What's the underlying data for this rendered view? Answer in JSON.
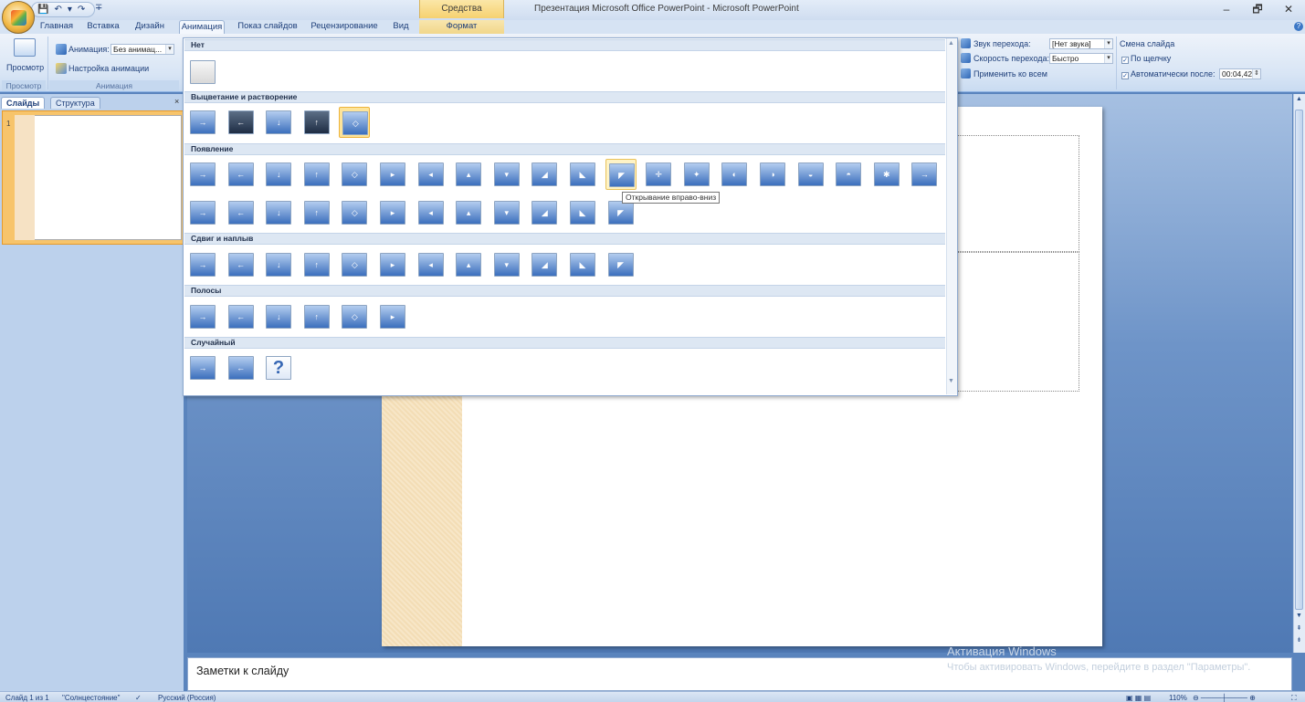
{
  "window": {
    "title": "Презентация Microsoft Office PowerPoint - Microsoft PowerPoint",
    "context_header": "Средства рисования",
    "minimize": "–",
    "maximize": "🗗",
    "close": "✕"
  },
  "qat": {
    "save": "💾",
    "undo": "↶",
    "undo_arrow": "▾",
    "redo": "↷",
    "customize": "∓"
  },
  "tabs": [
    "Главная",
    "Вставка",
    "Дизайн",
    "Анимация",
    "Показ слайдов",
    "Рецензирование",
    "Вид",
    "Формат"
  ],
  "ribbon": {
    "preview_group": {
      "button": "Просмотр",
      "label": "Просмотр"
    },
    "animation_group": {
      "animation_label": "Анимация:",
      "animation_value": "Без анимац...",
      "custom": "Настройка анимации",
      "label": "Анимация"
    },
    "sound_label": "Звук перехода:",
    "sound_value": "[Нет звука]",
    "speed_label": "Скорость перехода:",
    "speed_value": "Быстро",
    "apply_all": "Применить ко всем",
    "advance": {
      "title": "Смена слайда",
      "on_click": "По щелчку",
      "auto_after": "Автоматически после:",
      "time": "00:04,42"
    }
  },
  "left_panel": {
    "tab_slides": "Слайды",
    "tab_outline": "Структура",
    "close": "×",
    "slide_number": "1"
  },
  "gallery": {
    "categories": {
      "none": "Нет",
      "fade": "Выцветание и растворение",
      "wipe": "Появление",
      "push": "Сдвиг и наплыв",
      "stripes": "Полосы",
      "random": "Случайный"
    },
    "tooltip": "Открывание вправо-вниз",
    "question_glyph": "?"
  },
  "notes": {
    "placeholder": "Заметки к слайду"
  },
  "watermark": {
    "line1": "Активация Windows",
    "line2": "Чтобы активировать Windows, перейдите в раздел \"Параметры\"."
  },
  "status": {
    "slide": "Слайд 1 из 1",
    "theme": "\"Солнцестояние\"",
    "lang": "Русский (Россия)",
    "zoom": "110%"
  },
  "colors": {
    "ribbon": "#dbe6f4",
    "accent": "#15428b",
    "selection": "#fde49a"
  }
}
